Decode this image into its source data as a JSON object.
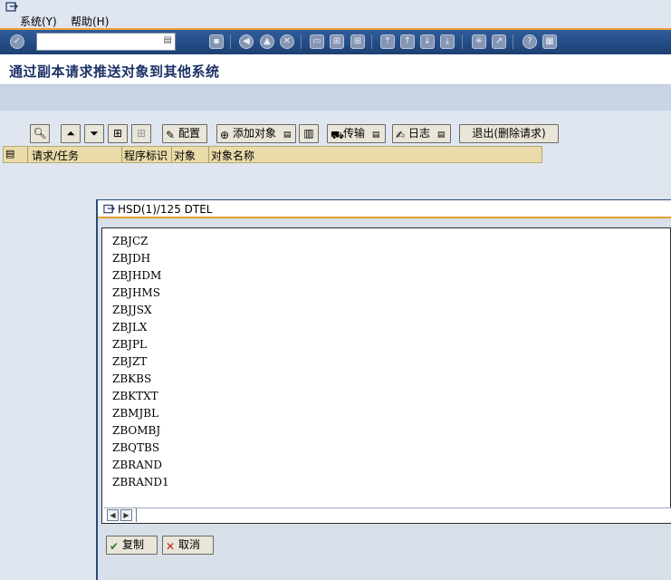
{
  "menu": {
    "items": [
      "系统(Y)",
      "帮助(H)"
    ]
  },
  "toolbar": {
    "command_value": ""
  },
  "page": {
    "title": "通过副本请求推送对象到其他系统"
  },
  "app_toolbar": {
    "config_label": "配置",
    "add_object_label": "添加对象",
    "transport_label": "传输",
    "log_label": "日志",
    "exit_label": "退出(删除请求)"
  },
  "table": {
    "columns": [
      "请求/任务",
      "程序标识",
      "对象",
      "对象名称"
    ]
  },
  "popup": {
    "title": "HSD(1)/125 DTEL",
    "items": [
      "ZBJCZ",
      "ZBJDH",
      "ZBJHDM",
      "ZBJHMS",
      "ZBJJSX",
      "ZBJLX",
      "ZBJPL",
      "ZBJZT",
      "ZBKBS",
      "ZBKTXT",
      "ZBMJBL",
      "ZBOMBJ",
      "ZBQTBS",
      "ZBRAND",
      "ZBRAND1"
    ],
    "copy_label": "复制",
    "cancel_label": "取消"
  },
  "colors": {
    "accent_orange": "#f0a035",
    "toolbar_blue": "#1c3f72",
    "header_tan": "#e9dca8"
  }
}
